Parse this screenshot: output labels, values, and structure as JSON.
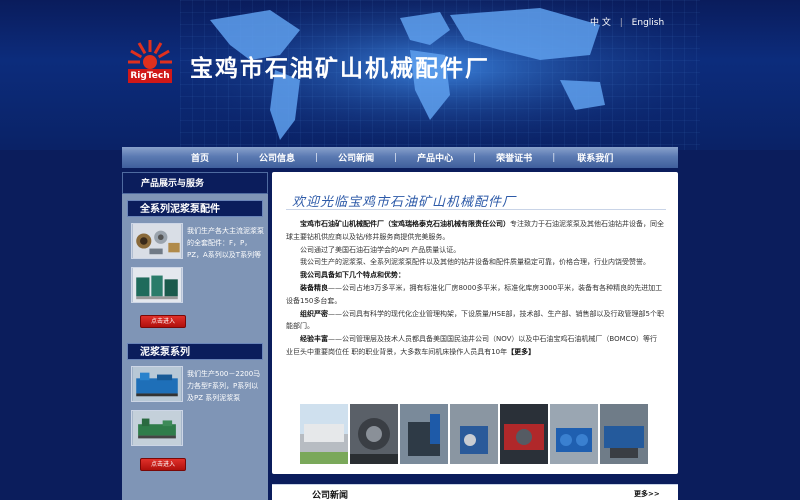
{
  "header": {
    "site_title": "宝鸡市石油矿山机械配件厂",
    "logo_text": "RigTech",
    "lang": {
      "zh": "中 文",
      "separator": "|",
      "en": "English"
    }
  },
  "nav": [
    {
      "label": "首页"
    },
    {
      "label": "公司信息"
    },
    {
      "label": "公司新闻"
    },
    {
      "label": "产品中心"
    },
    {
      "label": "荣誉证书"
    },
    {
      "label": "联系我们"
    }
  ],
  "nav_separator": "|",
  "sidebar": {
    "heading": "产品展示与服务",
    "categories": [
      {
        "title": "全系列泥浆泵配件",
        "desc": "我们生产各大主流泥浆泵的全套配件：F，P，PZ，A系列以及T系列等",
        "button": "点击进入"
      },
      {
        "title": "泥浆泵系列",
        "desc": "我们生产500－2200马力各型F系列，P系列以及PZ 系列泥浆泵",
        "button": "点击进入"
      }
    ]
  },
  "main": {
    "welcome": "欢迎光临宝鸡市石油矿山机械配件厂",
    "intro_company": "宝鸡市石油矿山机械配件厂（宝鸡瑞格泰克石油机械有限责任公司）",
    "intro_rest": "专注致力于石油泥浆泵及其他石油钻井设备，同全球主要钻机供应商以及钻/修井服务商提供完美服务。",
    "p2": "公司通过了美国石油石油学会的API 产品质量认证。",
    "p3": "我公司生产的泥浆泵、全系列泥浆泵配件以及其他的钻井设备和配件质量稳定可靠，价格合理，行业内饶受赞誉。",
    "features_title": "我公司具备如下几个特点和优势：",
    "features": [
      {
        "head": "装备精良",
        "text": "——公司占地3万多平米，拥有标准化厂房8000多平米，标准化库房3000平米，装备有各种精良的先进加工设备150多台套。"
      },
      {
        "head": "组织严密",
        "text": "——公司具有科学的现代化企业管理构架，下设质量/HSE部，技术部、生产部、销售部以及行政管理部5个职能部门。"
      },
      {
        "head": "经验丰富",
        "text": "——公司管理层及技术人员都具备美国国民油井公司（NOV）以及中石油宝鸡石油机械厂（BOMCO）等行业巨头中重要岗位任 职的职业背景，大多数车间机床操作人员具有10年"
      }
    ],
    "more_link": "【更多】"
  },
  "news": {
    "title": "公司新闻",
    "more": "更多>>"
  },
  "colors": {
    "accent": "#2d5aa8",
    "nav": "#5b7ab2",
    "page_bg": "#0b1d5c",
    "sidebar": "#7f95b6",
    "button": "#d01818"
  }
}
